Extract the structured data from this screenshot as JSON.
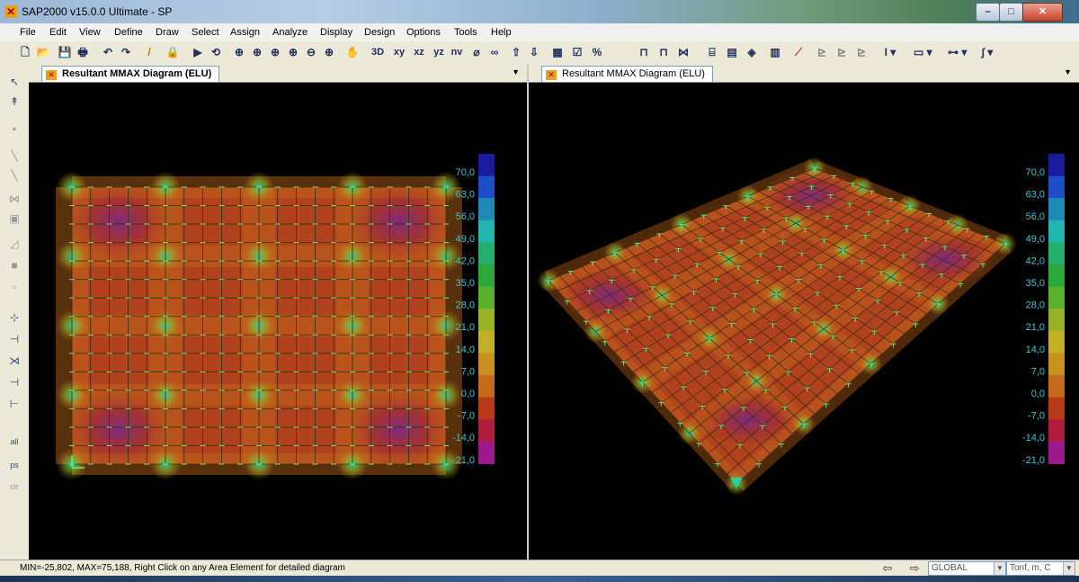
{
  "window": {
    "title": "SAP2000 v15.0.0 Ultimate  - SP",
    "min_label": "–",
    "max_label": "□",
    "close_label": "✕"
  },
  "menu": [
    "File",
    "Edit",
    "View",
    "Define",
    "Draw",
    "Select",
    "Assign",
    "Analyze",
    "Display",
    "Design",
    "Options",
    "Tools",
    "Help"
  ],
  "toolbar": {
    "view_labels": [
      "3D",
      "xy",
      "xz",
      "yz",
      "nv"
    ]
  },
  "panes": {
    "left": {
      "tab_title": "Resultant MMAX Diagram  (ELU)"
    },
    "right": {
      "tab_title": "Resultant MMAX Diagram  (ELU)"
    }
  },
  "legend": {
    "ticks": [
      "70,0",
      "63,0",
      "56,0",
      "49,0",
      "42,0",
      "35,0",
      "28,0",
      "21,0",
      "14,0",
      "7,0",
      "0,0",
      "-7,0",
      "-14,0",
      "-21,0"
    ],
    "colors": [
      "#1a1a9c",
      "#1d50c8",
      "#1e8ab8",
      "#22b6b0",
      "#24b06c",
      "#2aa83a",
      "#5ab02c",
      "#98b228",
      "#c4b026",
      "#c8901e",
      "#c46a1a",
      "#b83a18",
      "#b01c3c",
      "#9c1a8c"
    ]
  },
  "colors": {
    "plate_base": "#b0421e",
    "plate_light": "#c46a1a",
    "hot": "#7a2a86",
    "support": "#2ad0a0",
    "grid_line": "#3a2a10",
    "grid_tick": "#5ff07a"
  },
  "left_tools": {
    "labels": [
      "all",
      "ps",
      "clr"
    ]
  },
  "status": {
    "text": "MIN=-25,802, MAX=75,188, Right Click on any Area Element for detailed diagram",
    "coord_system": "GLOBAL",
    "units": "Tonf, m, C"
  }
}
